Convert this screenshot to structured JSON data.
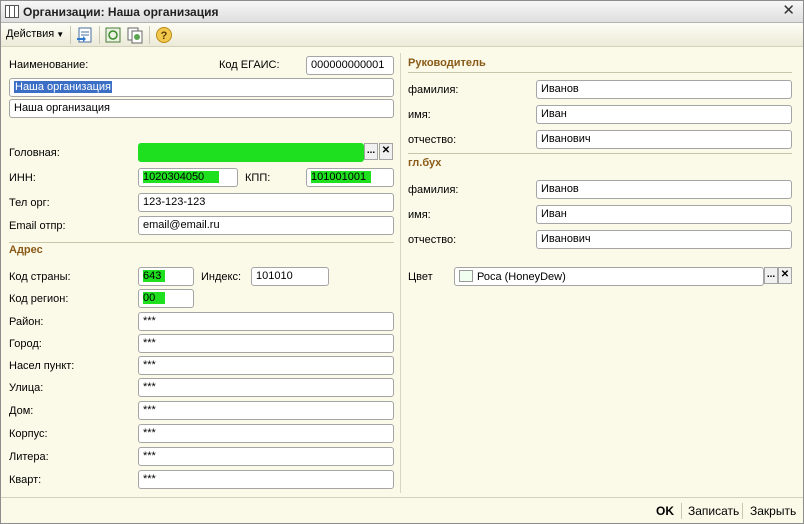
{
  "window": {
    "title": "Организации: Наша организация",
    "close_glyph": "✕"
  },
  "toolbar": {
    "actions_label": "Действия",
    "help_glyph": "?"
  },
  "form": {
    "name_label": "Наименование:",
    "egais_label": "Код ЕГАИС:",
    "egais_value": "000000000001",
    "name_value": "Наша организация",
    "full_name_value": "Наша организация",
    "parent_label": "Головная:",
    "inn_label": "ИНН:",
    "inn_value": "1020304050",
    "kpp_label": "КПП:",
    "kpp_value": "101001001",
    "phone_label": "Тел орг:",
    "phone_value": "123-123-123",
    "email_label": "Email отпр:",
    "email_value": "email@email.ru",
    "select_glyph": "...",
    "clear_glyph": "✕"
  },
  "address": {
    "title": "Адрес",
    "country_label": "Код страны:",
    "country_value": "643",
    "index_label": "Индекс:",
    "index_value": "101010",
    "region_label": "Код регион:",
    "region_value": "00",
    "rows": [
      {
        "label": "Район:",
        "value": "***"
      },
      {
        "label": "Город:",
        "value": "***"
      },
      {
        "label": "Насел пункт:",
        "value": "***"
      },
      {
        "label": "Улица:",
        "value": "***"
      },
      {
        "label": "Дом:",
        "value": "***"
      },
      {
        "label": "Корпус:",
        "value": "***"
      },
      {
        "label": "Литера:",
        "value": "***"
      },
      {
        "label": "Кварт:",
        "value": "***"
      }
    ]
  },
  "director": {
    "title": "Руководитель",
    "last_label": "фамилия:",
    "last_value": "Иванов",
    "first_label": "имя:",
    "first_value": "Иван",
    "middle_label": "отчество:",
    "middle_value": "Иванович"
  },
  "accountant": {
    "title": "гл.бух",
    "last_label": "фамилия:",
    "last_value": "Иванов",
    "first_label": "имя:",
    "first_value": "Иван",
    "middle_label": "отчество:",
    "middle_value": "Иванович"
  },
  "color": {
    "label": "Цвет",
    "value": "Роса (HoneyDew)"
  },
  "footer": {
    "ok_label": "OK",
    "save_label": "Записать",
    "close_label": "Закрыть"
  }
}
